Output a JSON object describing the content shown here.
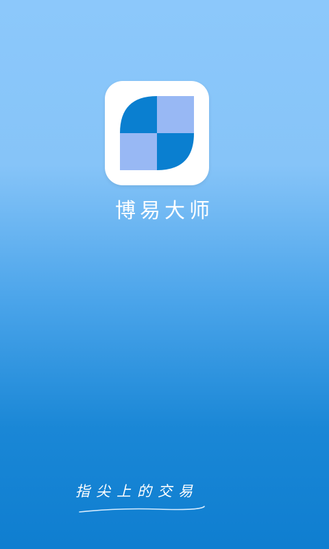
{
  "splash": {
    "app_name": "博易大师",
    "slogan": "指尖上的交易",
    "logo_icon": "four-quadrant-leaf-logo",
    "colors": {
      "background_top": "#8cc8fb",
      "background_bottom": "#0f7ed0",
      "logo_dark_blue": "#0a7fd0",
      "logo_light_blue": "#98b8f4",
      "text": "#ffffff"
    }
  }
}
